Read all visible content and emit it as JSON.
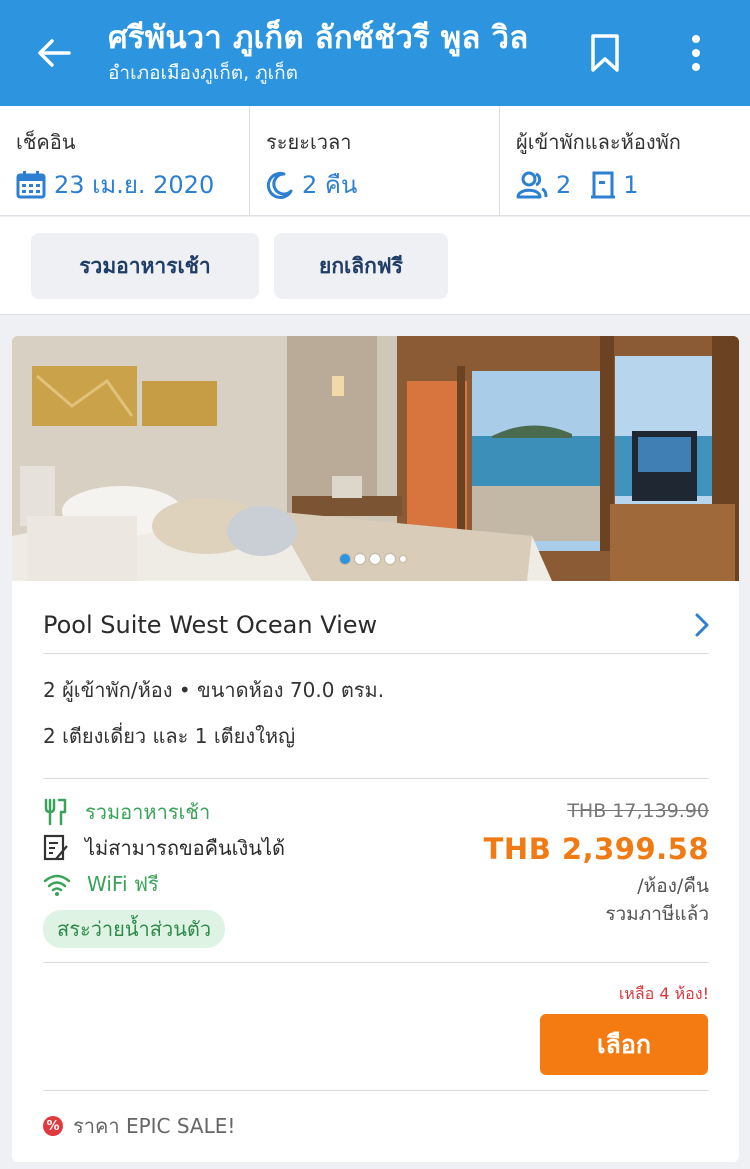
{
  "header": {
    "title": "ศรีพันวา ภูเก็ต ลักซ์ชัวรี พูล วิล",
    "subtitle": "อำเภอเมืองภูเก็ต, ภูเก็ต"
  },
  "booking": {
    "checkin_label": "เช็คอิน",
    "checkin_value": "23 เม.ย. 2020",
    "duration_label": "ระยะเวลา",
    "duration_value": "2 คืน",
    "guests_label": "ผู้เข้าพักและห้องพัก",
    "guests_count": "2",
    "rooms_count": "1"
  },
  "filters": [
    {
      "label": "รวมอาหารเช้า"
    },
    {
      "label": "ยกเลิกฟรี"
    }
  ],
  "room": {
    "photo_count": 5,
    "photo_active_index": 0,
    "name": "Pool Suite West Ocean View",
    "capacity": "2 ผู้เข้าพัก/ห้อง • ขนาดห้อง 70.0 ตรม.",
    "beds": "2 เตียงเดี่ยว และ 1 เตียงใหญ่",
    "amenities": [
      {
        "icon": "fork-knife-icon",
        "label": "รวมอาหารเช้า"
      },
      {
        "icon": "no-refund-icon",
        "label": "ไม่สามารถขอคืนเงินได้"
      },
      {
        "icon": "wifi-icon",
        "label": "WiFi ฟรี"
      }
    ],
    "pool_tag": "สระว่ายน้ำส่วนตัว",
    "old_price": "THB 17,139.90",
    "price": "THB 2,399.58",
    "price_unit": "/ห้อง/คืน",
    "tax_note": "รวมภาษีแล้ว",
    "rooms_left": "เหลือ 4 ห้อง!",
    "select_label": "เลือก",
    "sale_badge": "%",
    "sale_text": "ราคา EPIC SALE!"
  },
  "colors": {
    "header": "#2d95e0",
    "accent_blue": "#2d7fd0",
    "price_orange": "#f07a14",
    "button_orange": "#f47a12",
    "green": "#3aa35a"
  }
}
